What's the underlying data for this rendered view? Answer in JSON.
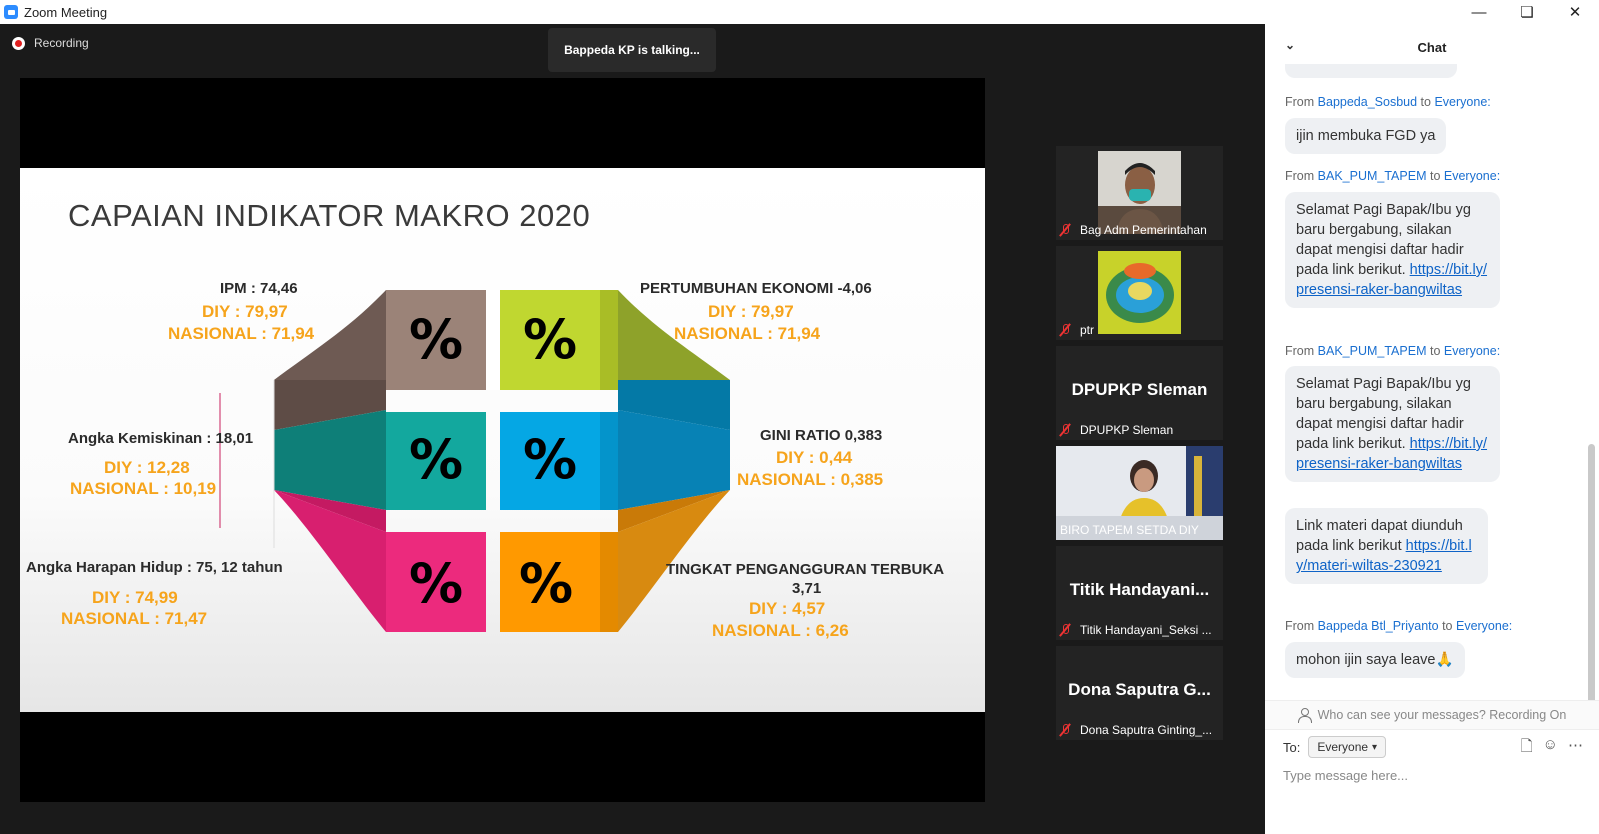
{
  "window": {
    "title": "Zoom Meeting"
  },
  "meeting": {
    "recording_label": "Recording",
    "talking_indicator": "Bappeda KP is talking...",
    "slide": {
      "title": "CAPAIAN INDIKATOR MAKRO 2020",
      "percent_symbol": "%",
      "ipm": {
        "label": "IPM : 74,46",
        "diy": "DIY : 79,97",
        "nasional": "NASIONAL : 71,94"
      },
      "kemiskinan": {
        "label": "Angka Kemiskinan  : 18,01",
        "diy": "DIY : 12,28",
        "nasional": "NASIONAL : 10,19"
      },
      "harapan_hidup": {
        "label": "Angka Harapan Hidup : 75, 12 tahun",
        "diy": "DIY : 74,99",
        "nasional": "NASIONAL : 71,47"
      },
      "pertumbuhan": {
        "label": "PERTUMBUHAN EKONOMI  -4,06",
        "diy": "DIY : 79,97",
        "nasional": "NASIONAL : 71,94"
      },
      "gini": {
        "label": "GINI RATIO 0,383",
        "diy": "DIY : 0,44",
        "nasional": "NASIONAL : 0,385"
      },
      "pengangguran": {
        "label": "TINGKAT PENGANGGURAN TERBUKA",
        "value": "3,71",
        "diy": "DIY : 4,57",
        "nasional": "NASIONAL : 6,26"
      }
    },
    "participants": [
      {
        "name": "Bag Adm Pemerintahan",
        "big_name": ""
      },
      {
        "name": "ptr",
        "big_name": ""
      },
      {
        "name": "DPUPKP Sleman",
        "big_name": "DPUPKP Sleman"
      },
      {
        "name": "BIRO TAPEM SETDA DIY",
        "big_name": ""
      },
      {
        "name": "Titik Handayani_Seksi ...",
        "big_name": "Titik  Handayani..."
      },
      {
        "name": "Dona Saputra Ginting_...",
        "big_name": "Dona Saputra G..."
      }
    ]
  },
  "chat": {
    "title": "Chat",
    "from_word": "From",
    "to_word": "to",
    "messages": [
      {
        "sender": "Bappeda_Sosbud",
        "recipient": "Everyone:",
        "text": "ijin membuka FGD ya"
      },
      {
        "sender": "BAK_PUM_TAPEM",
        "recipient": "Everyone:",
        "text": "Selamat Pagi Bapak/Ibu yg baru bergabung, silakan dapat mengisi daftar hadir pada link berikut.",
        "link": "https://bit.ly/presensi-raker-bangwiltas"
      },
      {
        "sender": "BAK_PUM_TAPEM",
        "recipient": "Everyone:",
        "text": "Selamat Pagi Bapak/Ibu yg baru bergabung, silakan dapat mengisi daftar hadir pada link berikut.",
        "link": "https://bit.ly/presensi-raker-bangwiltas"
      },
      {
        "sender": "",
        "recipient": "",
        "text": "Link materi dapat diunduh pada link berikut",
        "link": "https://bit.ly/materi-wiltas-230921"
      },
      {
        "sender": "Bappeda Btl_Priyanto",
        "recipient": "Everyone:",
        "text": "mohon ijin saya leave🙏"
      }
    ],
    "visibility_note": "Who can see your messages? Recording On",
    "to_label": "To:",
    "to_value": "Everyone",
    "input_placeholder": "Type message here..."
  },
  "colors": {
    "brown": "#9b8378",
    "teal": "#13a89e",
    "magenta": "#ec2a7d",
    "lime": "#c0d730",
    "blue": "#05a7e4",
    "orange": "#ff9900",
    "label_orange": "#f6a41c",
    "chat_link": "#0e63c7"
  },
  "icons": [
    "zoom-app-icon",
    "record-icon",
    "mic-muted-icon",
    "file-icon",
    "emoji-icon",
    "more-icon",
    "chevron-down-icon",
    "person-icon"
  ]
}
